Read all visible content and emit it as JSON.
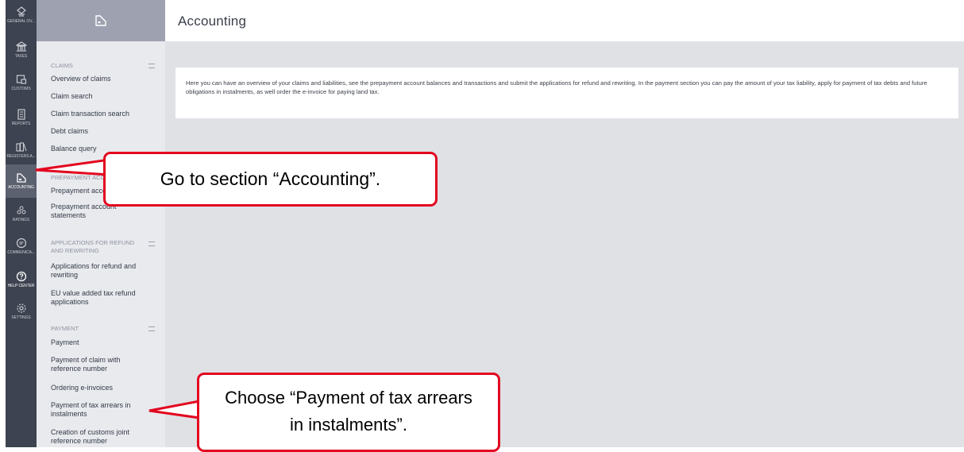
{
  "rail": {
    "items": [
      {
        "label": "GENERAL OV...",
        "icon": "general-overview-icon"
      },
      {
        "label": "TAXES",
        "icon": "bank-icon"
      },
      {
        "label": "CUSTOMS",
        "icon": "customs-icon"
      },
      {
        "label": "REPORTS",
        "icon": "reports-icon"
      },
      {
        "label": "REGISTERS A...",
        "icon": "registers-icon"
      },
      {
        "label": "ACCOUNTING",
        "icon": "accounting-icon",
        "active": true
      },
      {
        "label": "RATINGS",
        "icon": "ratings-icon"
      },
      {
        "label": "COMMUNICA...",
        "icon": "communication-icon"
      },
      {
        "label": "HELP CENTER",
        "icon": "help-icon"
      },
      {
        "label": "SETTINGS",
        "icon": "settings-icon"
      }
    ]
  },
  "subnav": {
    "claims": {
      "title": "CLAIMS",
      "links": [
        "Overview of claims",
        "Claim search",
        "Claim transaction search",
        "Debt claims",
        "Balance query"
      ]
    },
    "prepayment": {
      "title": "PREPAYMENT ACCOUNT",
      "links": [
        "Prepayment account",
        "Prepayment account statements"
      ]
    },
    "refund": {
      "title": "APPLICATIONS FOR REFUND AND REWRITING",
      "links": [
        "Applications for refund and rewriting",
        "EU value added tax refund applications"
      ]
    },
    "payment": {
      "title": "PAYMENT",
      "links": [
        "Payment",
        "Payment of claim with reference number",
        "Ordering e-invoices",
        "Payment of tax arrears in instalments",
        "Creation of customs joint reference number"
      ]
    }
  },
  "page": {
    "title": "Accounting",
    "intro": "Here you can have an overview of your claims and liabilities, see the prepayment account balances and transactions and submit the applications for refund and rewriting. In the payment section you can pay the amount of your tax liability, apply for payment of tax debts and future obligations in instalments, as well order the e-invoice for paying land tax."
  },
  "callouts": {
    "accounting": "Go to section “Accounting”.",
    "instalments": "Choose “Payment of tax arrears in instalments”."
  },
  "colors": {
    "callout_border": "#e3061f",
    "rail_bg": "#3d4350",
    "subnav_bg": "#e8eaee",
    "main_bg": "#dfe1e5"
  }
}
